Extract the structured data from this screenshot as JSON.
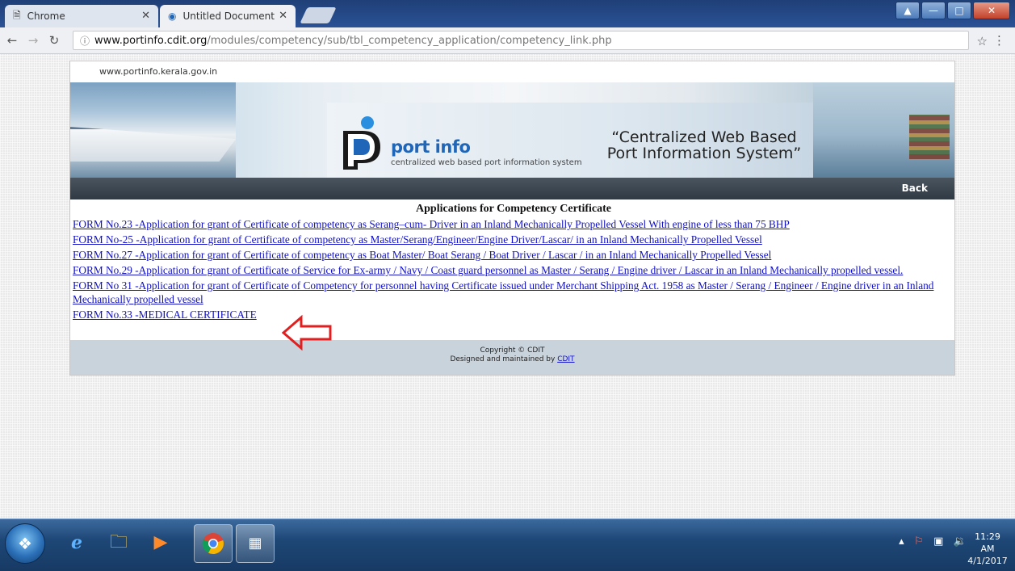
{
  "browser": {
    "tabs": [
      {
        "label": "Chrome",
        "icon": "page-icon"
      },
      {
        "label": "Untitled Document",
        "icon": "portinfo-favicon"
      }
    ],
    "url_host": "www.portinfo.cdit.org",
    "url_path": "/modules/competency/sub/tbl_competency_application/competency_link.php"
  },
  "site": {
    "top_url": "www.portinfo.kerala.gov.in",
    "logo_text": "port info",
    "logo_sub": "centralized web based port information system",
    "tagline_line1": "“Centralized Web Based",
    "tagline_line2": "Port Information System”",
    "back_label": "Back"
  },
  "content": {
    "title": "Applications for Competency Certificate",
    "forms": [
      "FORM No.23 -Application for grant of Certificate of competency as Serang–cum- Driver in an Inland Mechanically Propelled Vessel With engine of less than 75 BHP",
      "FORM No-25 -Application for grant of Certificate of competency as Master/Serang/Engineer/Engine Driver/Lascar/ in an Inland Mechanically Propelled Vessel",
      "FORM No.27 -Application for grant of Certificate of competency as Boat Master/ Boat Serang / Boat Driver / Lascar / in an Inland Mechanically Propelled Vessel",
      "FORM No.29 -Application for grant of Certificate of Service for Ex-army / Navy / Coast guard personnel as Master / Serang / Engine driver / Lascar in an Inland Mechanically propelled vessel.",
      "FORM No 31 -Application for grant of Certificate of Competency for personnel having Certificate issued under Merchant Shipping Act. 1958 as Master / Serang / Engineer / Engine driver in an Inland Mechanically propelled vessel",
      "FORM No.33 -MEDICAL CERTIFICATE"
    ]
  },
  "footer": {
    "copyright": "Copyright © CDIT",
    "designed_prefix": "Designed and maintained by",
    "designed_link": "CDIT"
  },
  "taskbar": {
    "time": "11:29 AM",
    "date": "4/1/2017",
    "colors": {
      "taskbar": "#1e4776",
      "link": "#1010c8",
      "arrow": "#e02020"
    }
  }
}
